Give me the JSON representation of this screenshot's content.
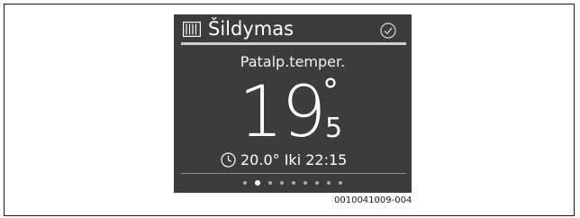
{
  "screen": {
    "title": "Šildymas",
    "title_icon": "radiator-icon",
    "status_icon": "check-circle-icon",
    "label": "Patalp.temper.",
    "temperature": {
      "integer": "19",
      "degree": "°",
      "decimal": "5"
    },
    "schedule": {
      "icon": "clock-icon",
      "text": "20.0° Iki 22:15"
    },
    "pagination": {
      "total_pages": 9,
      "active_index": 1
    }
  },
  "figure_code": "0010041009-004",
  "colors": {
    "screen_background": "#3c3c3c",
    "text": "#ffffff",
    "divider": "#cfcfcf",
    "dot_inactive": "#a9a9a9",
    "dot_active": "#ffffff"
  }
}
